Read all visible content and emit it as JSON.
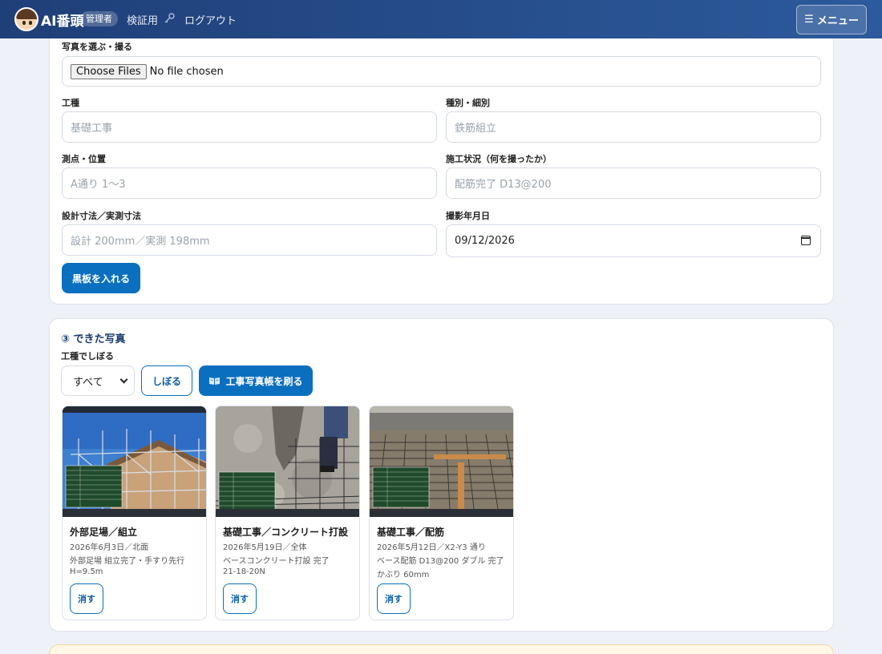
{
  "header": {
    "brand": "AI番頭",
    "role_badge": "管理者",
    "nav_verify": "検証用",
    "nav_logout": "ログアウト",
    "menu_label": "メニュー",
    "menu_icon": "☰"
  },
  "form": {
    "photo_label": "写真を選ぶ・撮る",
    "file_button": "Choose Files",
    "file_status": "No file chosen",
    "koushu": {
      "label": "工種",
      "placeholder": "基礎工事"
    },
    "shubetsu": {
      "label": "種別・細別",
      "placeholder": "鉄筋組立"
    },
    "sokuten": {
      "label": "測点・位置",
      "placeholder": "A通り 1〜3"
    },
    "jokyo": {
      "label": "施工状況（何を撮ったか）",
      "placeholder": "配筋完了 D13@200"
    },
    "sunpo": {
      "label": "設計寸法／実測寸法",
      "placeholder": "設計 200mm／実測 198mm"
    },
    "date": {
      "label": "撮影年月日",
      "value": "09/12/2026"
    },
    "submit": "黒板を入れる"
  },
  "photos_section": {
    "title": "③ できた写真",
    "filter_label": "工種でしぼる",
    "filter_value": "すべて",
    "filter_button": "しぼる",
    "album_button": "工事写真帳を刷る",
    "album_icon": "book-icon",
    "delete_label": "消す",
    "items": [
      {
        "title": "外部足場／組立",
        "line1": "2026年6月3日／北面",
        "line2": "外部足場 組立完了・手すり先行",
        "line3": "H=9.5m"
      },
      {
        "title": "基礎工事／コンクリート打設",
        "line1": "2026年5月19日／全体",
        "line2": "ベースコンクリート打設 完了",
        "line3": "21-18-20N"
      },
      {
        "title": "基礎工事／配筋",
        "line1": "2026年5月12日／X2-Y3 通り",
        "line2": "ベース配筋 D13@200 ダブル 完了",
        "line3": "かぶり 60mm"
      }
    ]
  },
  "colors": {
    "header": "#1f3f78",
    "primary": "#0b6fbf",
    "title": "#173a6b"
  }
}
